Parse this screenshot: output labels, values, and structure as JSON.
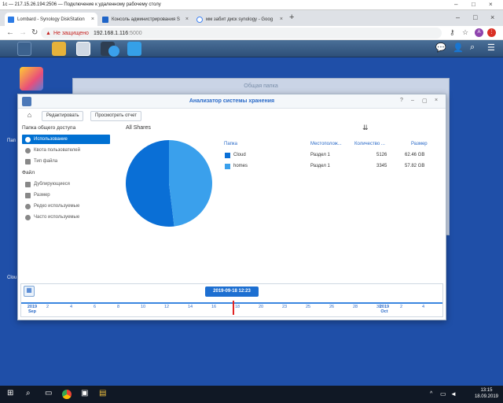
{
  "rdp": {
    "title": "1c — 217.15.26.194:2506 — Подключение к удаленному рабочему столу"
  },
  "browser": {
    "tabs": [
      {
        "label": "Lombard - Synology DiskStation",
        "active": true,
        "color": "#2c7be5"
      },
      {
        "label": "Консоль администрирования S",
        "active": false,
        "color": "#1e64c8"
      },
      {
        "label": "мм забит диск synology - Goog",
        "active": false,
        "color": "#4285f4"
      }
    ],
    "security": "Не защищено",
    "url": "192.168.1.116",
    "port": ":5000"
  },
  "desktop": {
    "label_a": "Пап",
    "label_b": "Clou"
  },
  "bg_window": {
    "title": "Общая папка"
  },
  "window": {
    "title": "Анализатор системы хранения",
    "toolbar": {
      "edit": "Редактировать",
      "view_report": "Просмотреть отчет"
    },
    "nav": {
      "section1": "Папка общего доступа",
      "items1": [
        "Использование",
        "Квота пользователей",
        "Тип файла"
      ],
      "section2": "Файл",
      "items2": [
        "Дублирующиеся",
        "Размер",
        "Редко используемые",
        "Часто используемые"
      ]
    },
    "content_title": "All Shares",
    "table": {
      "headers": [
        "Папка",
        "Местополож...",
        "Количество ...",
        "Размер"
      ],
      "rows": [
        {
          "name": "Cloud",
          "location": "Раздел 1",
          "count": "5126",
          "size": "62.46 GB",
          "color": "#0a6fd6"
        },
        {
          "name": "homes",
          "location": "Раздел 1",
          "count": "3345",
          "size": "57.82 GB",
          "color": "#3aa0ec"
        }
      ]
    },
    "timeline": {
      "date": "2019-09-18 12:23",
      "year_start": "2019",
      "month_start": "Sep",
      "ticks": [
        "2",
        "4",
        "6",
        "8",
        "10",
        "12",
        "14",
        "16",
        "18",
        "20",
        "23",
        "25",
        "26",
        "28",
        "30"
      ],
      "year_end": "2019",
      "month_end": "Oct",
      "ticks_after": [
        "2",
        "4"
      ]
    }
  },
  "taskbar": {
    "time": "13:15",
    "date": "18.09.2019"
  },
  "chart_data": {
    "type": "pie",
    "title": "All Shares",
    "labels": [
      "Cloud",
      "homes"
    ],
    "values": [
      62.46,
      57.82
    ],
    "units": "GB",
    "colors": [
      "#0a6fd6",
      "#3aa0ec"
    ]
  }
}
